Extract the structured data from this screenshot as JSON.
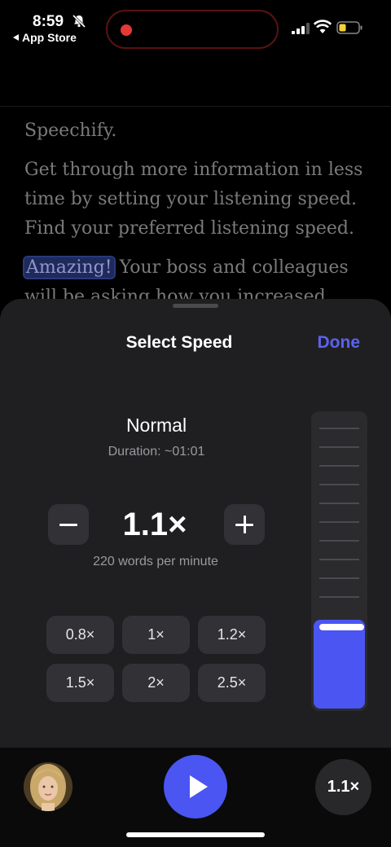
{
  "status_bar": {
    "time": "8:59",
    "back_app": "App Store"
  },
  "reader": {
    "paragraphs": [
      "Speechify.",
      "Get through more information in less time by setting your listening speed. Find your preferred listening speed."
    ],
    "highlight": "Amazing!",
    "last_paragraph_rest": " Your boss and colleagues will be asking how you increased your"
  },
  "sheet": {
    "title": "Select Speed",
    "done_label": "Done",
    "mode_label": "Normal",
    "duration": "Duration: ~01:01",
    "minus_label": "−",
    "plus_label": "+",
    "speed_value": "1.1×",
    "wpm": "220 words per minute",
    "presets": [
      "0.8×",
      "1×",
      "1.2×",
      "1.5×",
      "2×",
      "2.5×"
    ],
    "slider_level": 0.3
  },
  "player": {
    "speed_chip": "1.1×"
  },
  "colors": {
    "accent": "#4a55f2",
    "done": "#5a62f0",
    "recording": "#e53935"
  },
  "icons": [
    "bell-slash-icon",
    "recording-dot-icon",
    "signal-icon",
    "wifi-icon",
    "battery-icon",
    "minus-icon",
    "plus-icon",
    "play-icon"
  ]
}
